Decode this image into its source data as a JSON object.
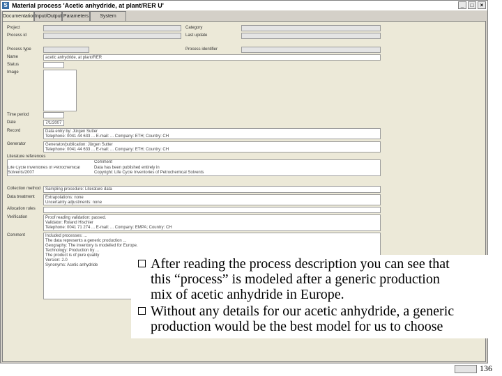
{
  "window": {
    "title": "Material process 'Acetic anhydride, at plant/RER U'",
    "app_icon": "S"
  },
  "tabs": [
    "Documentation",
    "Input/Output",
    "Parameters",
    "System description"
  ],
  "left_labels": {
    "project": "Project",
    "process_id": "Process id",
    "process_type": "Process type",
    "name": "Name",
    "status": "Status",
    "image": "Image",
    "time_period": "Time period",
    "date": "Date",
    "record": "Record",
    "generator": "Generator",
    "literature_references": "Literature references",
    "collection_method": "Collection method",
    "data_treatment": "Data treatment",
    "allocation_rules": "Allocation rules",
    "verification": "Verification",
    "comment": "Comment"
  },
  "right_labels": {
    "category": "Category",
    "last_update": "Last update",
    "process_id_right": "Process identifier"
  },
  "values": {
    "name": "acetic anhydride, at plant/RER",
    "date": "7/1/2007",
    "literature_header": "Comment",
    "literature_left": "Life Cycle Inventories of Petrochemical Solvents/2007",
    "literature_right": "Data has been published entirely in\nCopyright: Life Cycle Inventories of Petrochemical Solvents",
    "record": "Data entry by: Jürgen Sutter\nTelephone: 0041 44 633 ... E-mail: ... Company: ETH; Country: CH",
    "generator": "Generator/publication: Jürgen Sutter\nTelephone: 0041 44 633 ... E-mail: ... Company: ETH; Country: CH",
    "collection_method": "Sampling procedure: Literature data",
    "data_treatment": "Extrapolations: none\nUncertainty adjustments: none",
    "verification": "Proof reading validation: passed.\nValidator: Roland Hischier\nTelephone: 0041 71 274 ... E-mail: ... Company: EMPA; Country: CH",
    "comment": "Included processes: ...\nThe data represents a generic production ...\nGeography: The inventory is modelled for Europe.\nTechnology: Production by ...\nThe product is of pure quality\nVersion: 2.0\nSynonyms: Acetic anhydride"
  },
  "slide": {
    "bullets": [
      {
        "lines": [
          "After reading the process description you can see that",
          "this “process” is modeled after a generic production",
          "mix of acetic anhydride in Europe."
        ]
      },
      {
        "lines": [
          "Without any details for our acetic anhydride, a generic",
          "production would be the best model for us to choose"
        ]
      }
    ],
    "page_number": "136"
  }
}
